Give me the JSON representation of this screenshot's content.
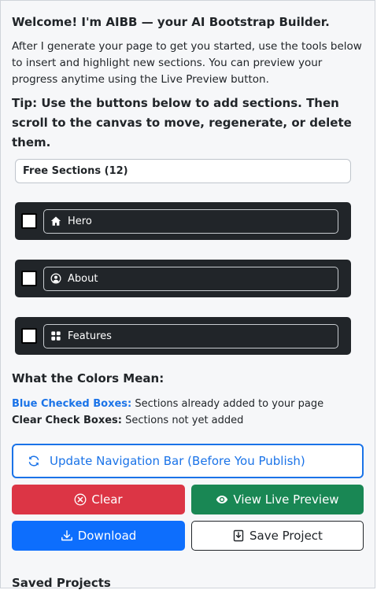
{
  "header": {
    "welcome": "Welcome! I'm AIBB — your AI Bootstrap Builder.",
    "intro": "After I generate your page to get you started, use the tools below to insert and highlight new sections. You can preview your progress anytime using the Live Preview button.",
    "tip": "Tip: Use the buttons below to add sections. Then scroll to the canvas to move, regenerate, or delete them."
  },
  "sections": {
    "title": "Free Sections (12)",
    "items": [
      {
        "label": "Hero",
        "icon": "house-icon",
        "checked": false
      },
      {
        "label": "About",
        "icon": "user-circle-icon",
        "checked": false
      },
      {
        "label": "Features",
        "icon": "grid-icon",
        "checked": false
      }
    ]
  },
  "legend": {
    "heading": "What the Colors Mean:",
    "blue_label": "Blue Checked Boxes:",
    "blue_text": " Sections already added to your page",
    "clear_label": "Clear Check Boxes:",
    "clear_text": " Sections not yet added"
  },
  "actions": {
    "update_nav": "Update Navigation Bar (Before You Publish)",
    "clear": "Clear",
    "live_preview": "View Live Preview",
    "download": "Download",
    "save_project": "Save Project"
  },
  "saved": {
    "heading": "Saved Projects"
  },
  "colors": {
    "accent_blue": "#1a73e8",
    "danger": "#dc3545",
    "success": "#198754",
    "primary": "#0d6efd",
    "dark": "#212529"
  }
}
